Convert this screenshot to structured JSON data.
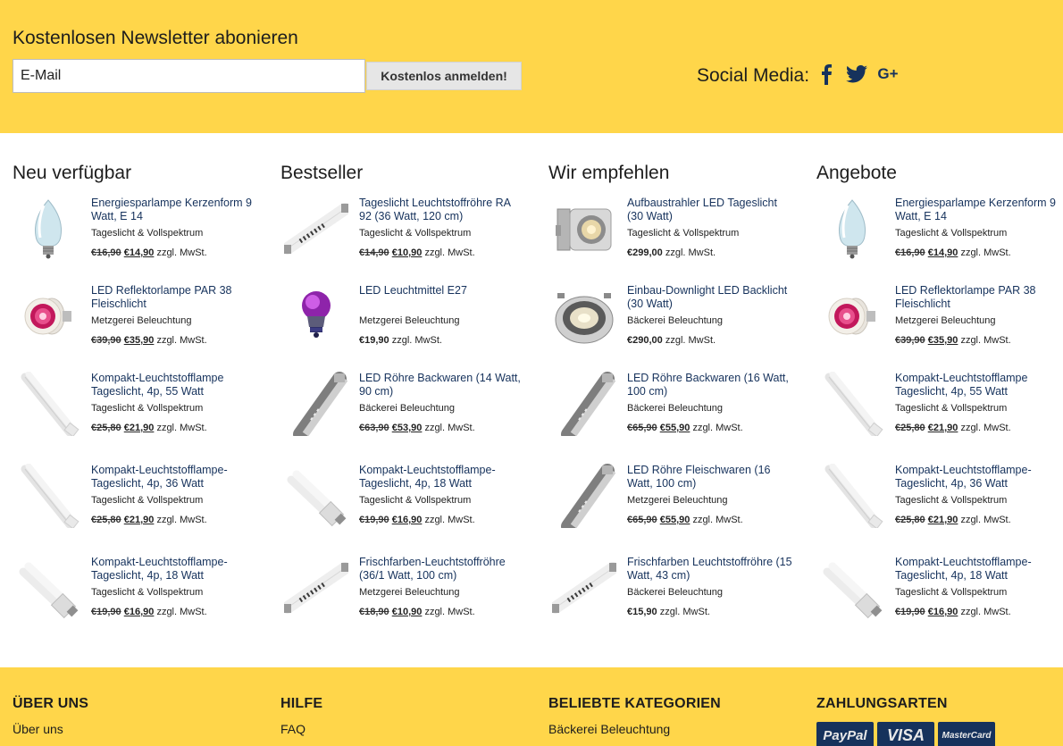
{
  "newsletter": {
    "title": "Kostenlosen Newsletter abonieren",
    "email_value": "E-Mail",
    "button_label": "Kostenlos anmelden!",
    "social_label": "Social Media:",
    "social_icons": [
      "facebook-icon",
      "twitter-icon",
      "google-plus-icon"
    ],
    "gplus_glyph": "G+"
  },
  "colors": {
    "banner": "#ffd64a",
    "link": "#16325c",
    "text": "#1d1d1d"
  },
  "columns": [
    {
      "title": "Neu verfügbar",
      "products": [
        {
          "name": "Energiesparlampe Kerzenform 9 Watt, E 14",
          "category": "Tageslicht & Vollspektrum",
          "old_price": "€16,90",
          "price": "€14,90",
          "tax": "zzgl. MwSt.",
          "icon": "candle-bulb-icon"
        },
        {
          "name": "LED Reflektorlampe PAR 38 Fleischlicht",
          "category": "Metzgerei Beleuchtung",
          "old_price": "€39,90",
          "price": "€35,90",
          "tax": "zzgl. MwSt.",
          "icon": "par-reflector-icon"
        },
        {
          "name": "Kompakt-Leuchtstofflampe Tageslicht, 4p, 55 Watt",
          "category": "Tageslicht & Vollspektrum",
          "old_price": "€25,80",
          "price": "€21,90",
          "tax": "zzgl. MwSt.",
          "icon": "compact-tube-long-icon"
        },
        {
          "name": "Kompakt-Leuchtstofflampe-Tageslicht, 4p, 36 Watt",
          "category": "Tageslicht & Vollspektrum",
          "old_price": "€25,80",
          "price": "€21,90",
          "tax": "zzgl. MwSt.",
          "icon": "compact-tube-long-icon"
        },
        {
          "name": "Kompakt-Leuchtstofflampe-Tageslicht, 4p, 18 Watt",
          "category": "Tageslicht & Vollspektrum",
          "old_price": "€19,90",
          "price": "€16,90",
          "tax": "zzgl. MwSt.",
          "icon": "compact-tube-short-icon"
        }
      ]
    },
    {
      "title": "Bestseller",
      "products": [
        {
          "name": "Tageslicht Leuchtstoffröhre RA 92 (36 Watt, 120 cm)",
          "category": "Tageslicht & Vollspektrum",
          "old_price": "€14,90",
          "price": "€10,90",
          "tax": "zzgl. MwSt.",
          "icon": "fluorescent-tube-icon"
        },
        {
          "name": "LED Leuchtmittel E27",
          "category": "Metzgerei Beleuchtung",
          "old_price": "",
          "price": "€19,90",
          "tax": "zzgl. MwSt.",
          "icon": "led-bulb-purple-icon"
        },
        {
          "name": "LED Röhre Backwaren (14 Watt, 90 cm)",
          "category": "Bäckerei Beleuchtung",
          "old_price": "€63,90",
          "price": "€53,90",
          "tax": "zzgl. MwSt.",
          "icon": "led-tube-icon"
        },
        {
          "name": "Kompakt-Leuchtstofflampe-Tageslicht, 4p, 18 Watt",
          "category": "Tageslicht & Vollspektrum",
          "old_price": "€19,90",
          "price": "€16,90",
          "tax": "zzgl. MwSt.",
          "icon": "compact-tube-short-icon"
        },
        {
          "name": "Frischfarben-Leuchtstoffröhre (36/1 Watt, 100 cm)",
          "category": "Metzgerei Beleuchtung",
          "old_price": "€18,90",
          "price": "€10,90",
          "tax": "zzgl. MwSt.",
          "icon": "fluorescent-tube-icon"
        }
      ]
    },
    {
      "title": "Wir empfehlen",
      "products": [
        {
          "name": "Aufbaustrahler LED Tageslicht (30 Watt)",
          "category": "Tageslicht & Vollspektrum",
          "old_price": "",
          "price": "€299,00",
          "tax": "zzgl. MwSt.",
          "icon": "track-spotlight-icon"
        },
        {
          "name": "Einbau-Downlight LED Backlicht (30 Watt)",
          "category": "Bäckerei Beleuchtung",
          "old_price": "",
          "price": "€290,00",
          "tax": "zzgl. MwSt.",
          "icon": "downlight-icon"
        },
        {
          "name": "LED Röhre Backwaren (16 Watt, 100 cm)",
          "category": "Bäckerei Beleuchtung",
          "old_price": "€65,90",
          "price": "€55,90",
          "tax": "zzgl. MwSt.",
          "icon": "led-tube-icon"
        },
        {
          "name": "LED Röhre Fleischwaren (16 Watt, 100 cm)",
          "category": "Metzgerei Beleuchtung",
          "old_price": "€65,90",
          "price": "€55,90",
          "tax": "zzgl. MwSt.",
          "icon": "led-tube-icon"
        },
        {
          "name": "Frischfarben Leuchtstoffröhre (15 Watt, 43 cm)",
          "category": "Bäckerei Beleuchtung",
          "old_price": "",
          "price": "€15,90",
          "tax": "zzgl. MwSt.",
          "icon": "fluorescent-tube-icon"
        }
      ]
    },
    {
      "title": "Angebote",
      "products": [
        {
          "name": "Energiesparlampe Kerzenform 9 Watt, E 14",
          "category": "Tageslicht & Vollspektrum",
          "old_price": "€16,90",
          "price": "€14,90",
          "tax": "zzgl. MwSt.",
          "icon": "candle-bulb-icon"
        },
        {
          "name": "LED Reflektorlampe PAR 38 Fleischlicht",
          "category": "Metzgerei Beleuchtung",
          "old_price": "€39,90",
          "price": "€35,90",
          "tax": "zzgl. MwSt.",
          "icon": "par-reflector-icon"
        },
        {
          "name": "Kompakt-Leuchtstofflampe Tageslicht, 4p, 55 Watt",
          "category": "Tageslicht & Vollspektrum",
          "old_price": "€25,80",
          "price": "€21,90",
          "tax": "zzgl. MwSt.",
          "icon": "compact-tube-long-icon"
        },
        {
          "name": "Kompakt-Leuchtstofflampe-Tageslicht, 4p, 36 Watt",
          "category": "Tageslicht & Vollspektrum",
          "old_price": "€25,80",
          "price": "€21,90",
          "tax": "zzgl. MwSt.",
          "icon": "compact-tube-long-icon"
        },
        {
          "name": "Kompakt-Leuchtstofflampe-Tageslicht, 4p, 18 Watt",
          "category": "Tageslicht & Vollspektrum",
          "old_price": "€19,90",
          "price": "€16,90",
          "tax": "zzgl. MwSt.",
          "icon": "compact-tube-short-icon"
        }
      ]
    }
  ],
  "footer": {
    "about": {
      "heading": "ÜBER UNS",
      "links": [
        "Über uns"
      ]
    },
    "help": {
      "heading": "HILFE",
      "links": [
        "FAQ"
      ]
    },
    "categories": {
      "heading": "BELIEBTE KATEGORIEN",
      "links": [
        "Bäckerei Beleuchtung"
      ]
    },
    "payment": {
      "heading": "ZAHLUNGSARTEN",
      "methods": [
        "PayPal",
        "VISA",
        "MasterCard"
      ]
    }
  }
}
